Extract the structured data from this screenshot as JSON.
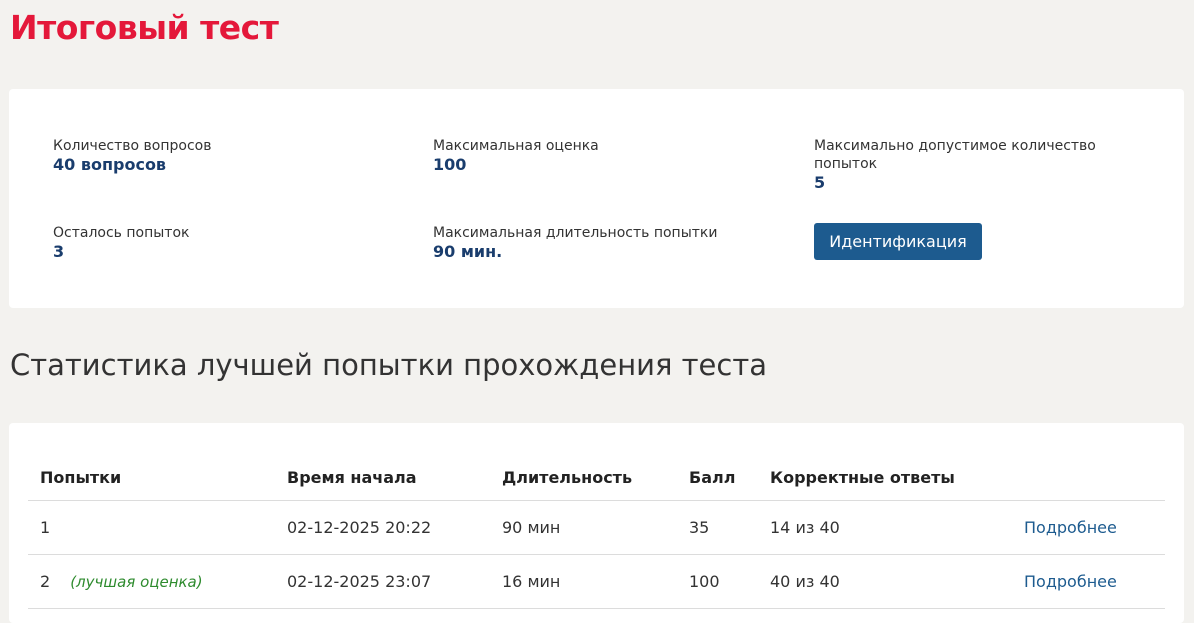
{
  "page": {
    "title": "Итоговый тест"
  },
  "info": {
    "questions_label": "Количество вопросов",
    "questions_value": "40 вопросов",
    "max_score_label": "Максимальная оценка",
    "max_score_value": "100",
    "max_attempts_label": "Максимально допустимое количество попыток",
    "max_attempts_value": "5",
    "remaining_label": "Осталось попыток",
    "remaining_value": "3",
    "max_duration_label": "Максимальная длительность попытки",
    "max_duration_value": "90 мин.",
    "ident_button": "Идентификация"
  },
  "stats": {
    "title": "Статистика лучшей попытки прохождения теста",
    "columns": [
      "Попытки",
      "Время начала",
      "Длительность",
      "Балл",
      "Корректные ответы",
      ""
    ],
    "rows": [
      {
        "attempt": "1",
        "note": "",
        "start": "02-12-2025 20:22",
        "duration": "90 мин",
        "score": "35",
        "correct": "14 из 40",
        "link": "Подробнее"
      },
      {
        "attempt": "2",
        "note": "(лучшая оценка)",
        "start": "02-12-2025 23:07",
        "duration": "16 мин",
        "score": "100",
        "correct": "40 из 40",
        "link": "Подробнее"
      }
    ]
  }
}
